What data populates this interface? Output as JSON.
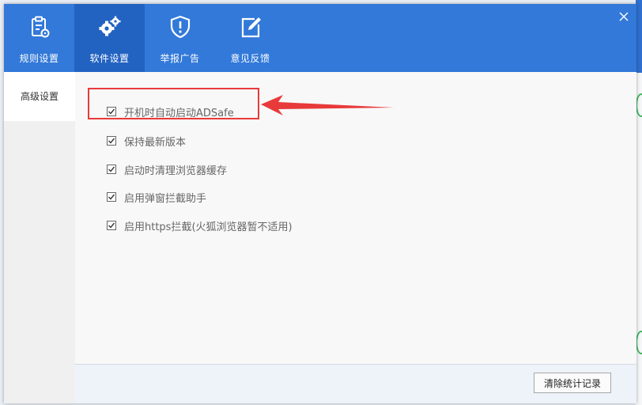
{
  "tabs": [
    {
      "label": "规则设置",
      "icon": "clipboard-gear-icon",
      "active": false
    },
    {
      "label": "软件设置",
      "icon": "gears-icon",
      "active": true
    },
    {
      "label": "举报广告",
      "icon": "shield-alert-icon",
      "active": false
    },
    {
      "label": "意见反馈",
      "icon": "edit-icon",
      "active": false
    }
  ],
  "sidebar": {
    "items": [
      {
        "label": "高级设置"
      }
    ]
  },
  "options": [
    {
      "label": "开机时自动启动ADSafe",
      "checked": true
    },
    {
      "label": "保持最新版本",
      "checked": true
    },
    {
      "label": "启动时清理浏览器缓存",
      "checked": true
    },
    {
      "label": "启用弹窗拦截助手",
      "checked": true
    },
    {
      "label": "启用https拦截(火狐浏览器暂不适用)",
      "checked": true
    }
  ],
  "footer": {
    "clear_stats_label": "清除统计记录"
  },
  "colors": {
    "titlebar": "#3279d9",
    "active_tab": "#2263c2",
    "annotation": "#e83a3a"
  }
}
